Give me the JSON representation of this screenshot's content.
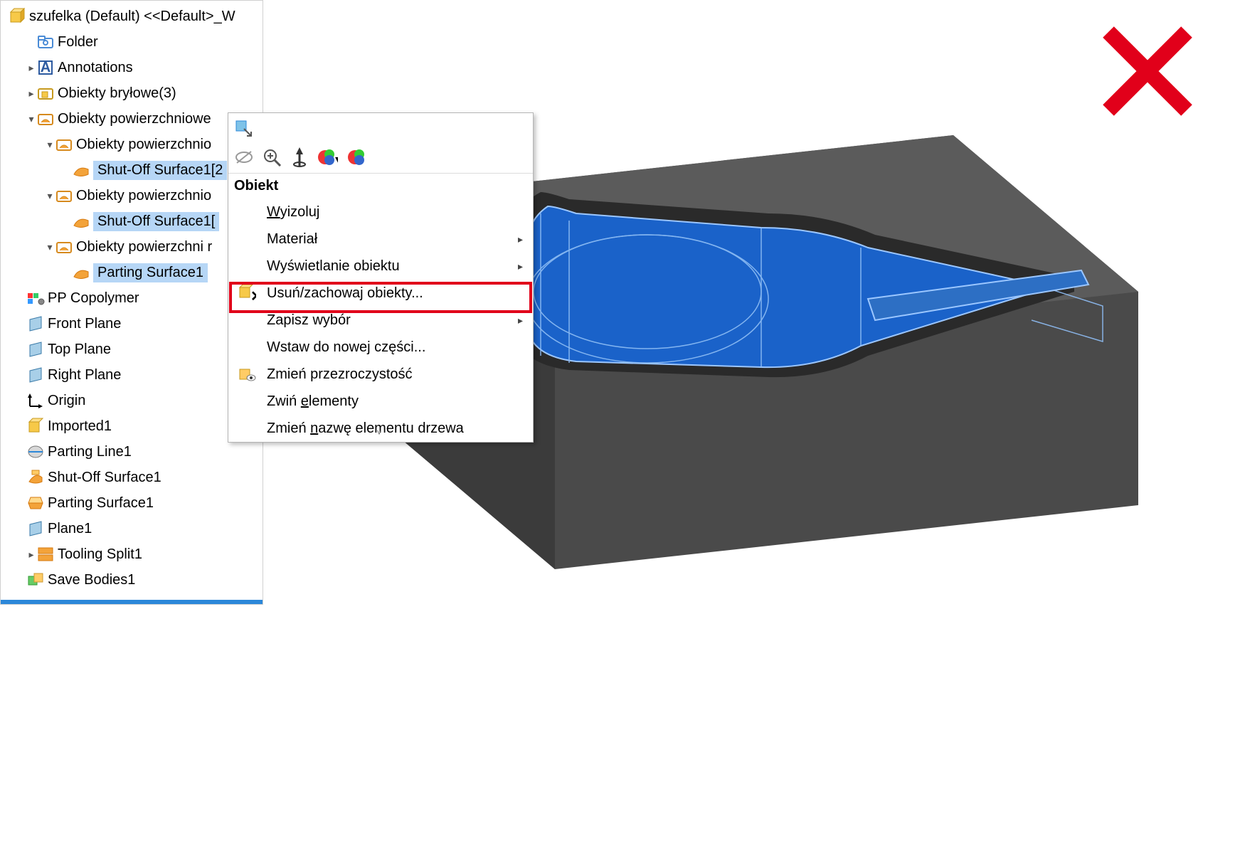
{
  "tree": {
    "root": "szufelka (Default) <<Default>_W",
    "folder": "Folder",
    "annotations": "Annotations",
    "solids": "Obiekty bryłowe(3)",
    "surfaces": "Obiekty powierzchniowe",
    "surfGrp1": "Obiekty powierzchnio",
    "shutoff1": "Shut-Off Surface1[2",
    "surfGrp2": "Obiekty powierzchnio",
    "shutoff2": "Shut-Off Surface1[",
    "surfGrp3": "Obiekty powierzchni r",
    "parting": "Parting Surface1",
    "material": "PP Copolymer",
    "front": "Front Plane",
    "top": "Top Plane",
    "right": "Right Plane",
    "origin": "Origin",
    "imported": "Imported1",
    "pline": "Parting Line1",
    "shutfeat": "Shut-Off Surface1",
    "psurffeat": "Parting Surface1",
    "plane1": "Plane1",
    "tooling": "Tooling Split1",
    "save": "Save Bodies1"
  },
  "ctx": {
    "header": "Obiekt",
    "isolate": "Wyizoluj",
    "material": "Materiał",
    "display": "Wyświetlanie obiektu",
    "deletekeep": "Usuń/zachowaj obiekty...",
    "savesel": "Zapisz wybór",
    "insertnew": "Wstaw do nowej części...",
    "transparency": "Zmień przezroczystość",
    "collapse": "Zwiń elementy",
    "rename": "Zmień nazwę elementu drzewa",
    "iso_u": "W",
    "coll_u": "e",
    "ren_u": "n"
  }
}
